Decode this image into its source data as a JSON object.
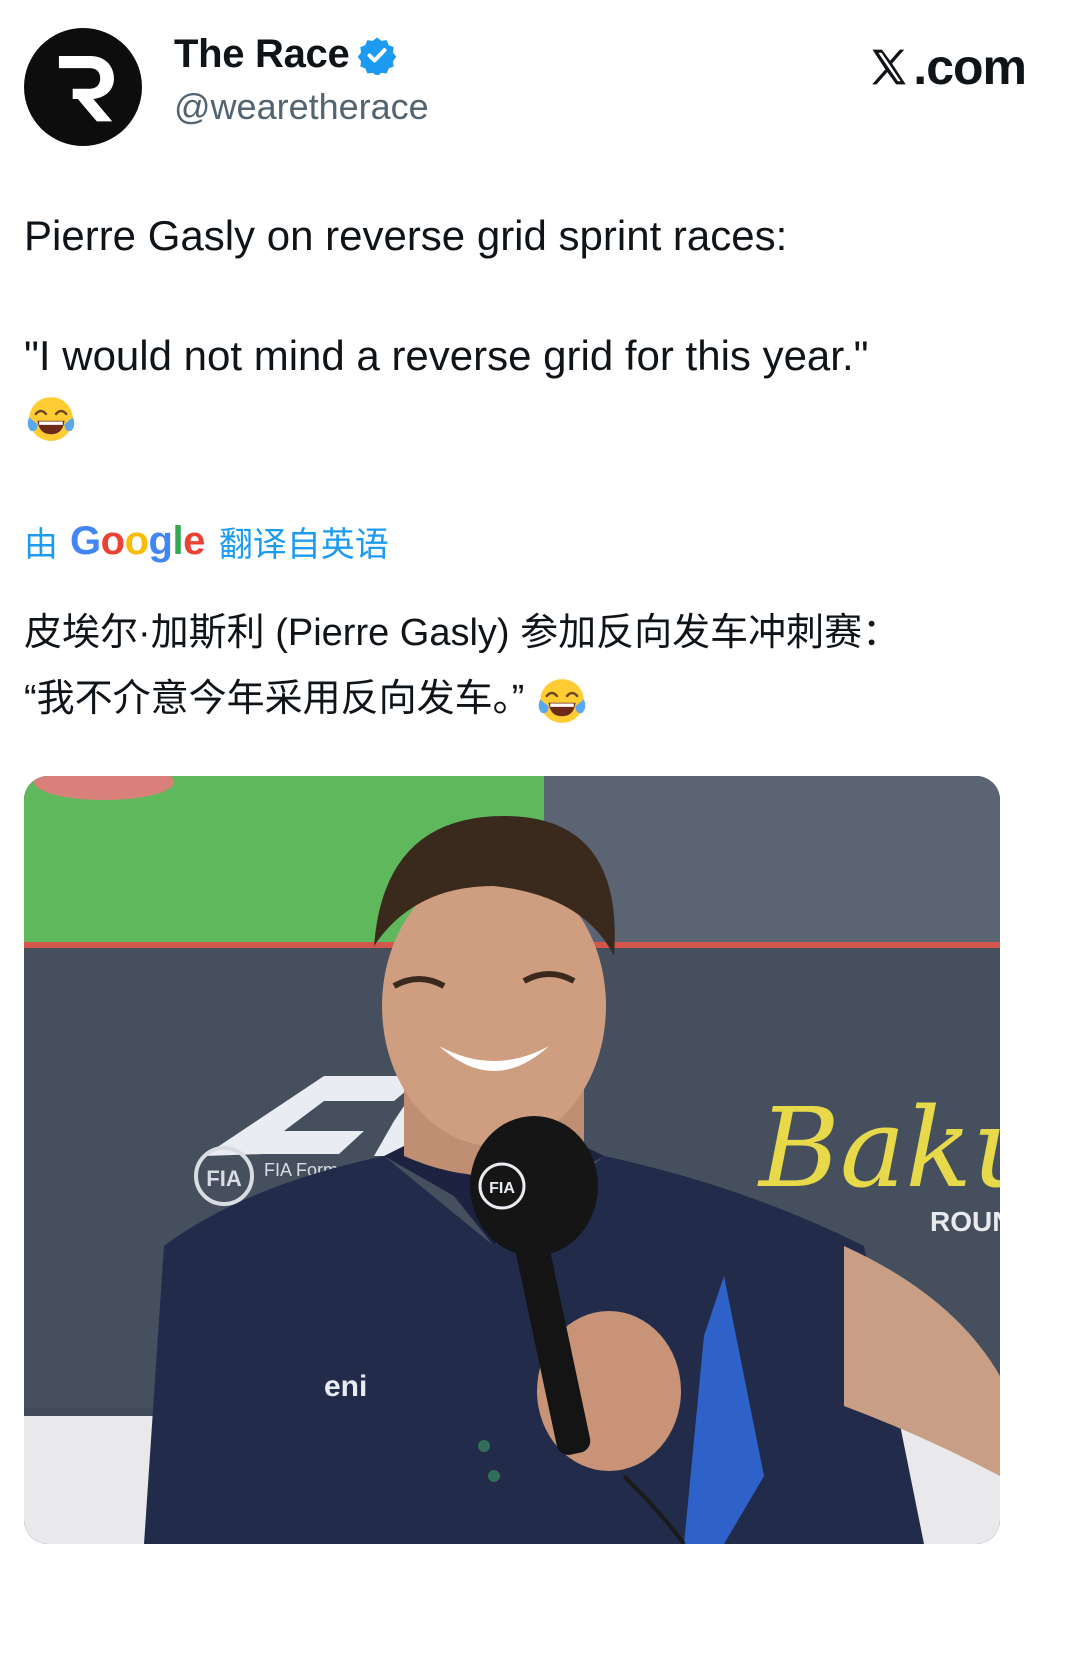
{
  "author": {
    "display_name": "The Race",
    "handle": "@wearetherace",
    "avatar_icon": "the-race-logo-icon",
    "verified_icon": "verified-badge-icon"
  },
  "brand": {
    "label": ".com",
    "icon": "x-logo-icon"
  },
  "tweet": {
    "line1": "Pierre Gasly on reverse grid sprint races:",
    "line2": "\"I would not mind a reverse grid for this year.\"",
    "emoji": "face-with-tears-of-joy-emoji"
  },
  "translation": {
    "prefix": "由",
    "provider": "Google",
    "suffix": "翻译自英语",
    "line1": "皮埃尔·加斯利 (Pierre Gasly) 参加反向发车冲刺赛：",
    "line2": "“我不介意今年采用反向发车。”",
    "emoji": "face-with-tears-of-joy-emoji"
  },
  "media": {
    "photo_name": "press-conference-photo",
    "backdrop_text": "Baku",
    "backdrop_round": "ROUND",
    "fia_text": "FIA",
    "fia_sub": "FIA Form",
    "shirt_sponsor": "eni",
    "mic_logo": "FIA"
  },
  "colors": {
    "accent": "#1d9bf0",
    "text": "#0f1419",
    "secondary": "#536471"
  }
}
